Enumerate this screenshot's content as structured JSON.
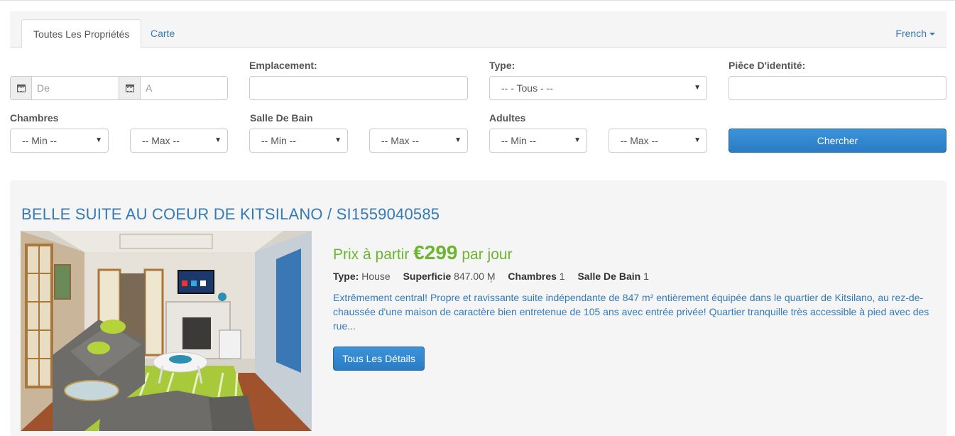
{
  "tabs": [
    {
      "label": "Toutes Les Propriétés",
      "active": true
    },
    {
      "label": "Carte",
      "active": false
    }
  ],
  "language": "French",
  "search": {
    "date_from_placeholder": "De",
    "date_to_placeholder": "A",
    "location_label": "Emplacement:",
    "location_value": "",
    "type_label": "Type:",
    "type_selected": "-- - Tous - --",
    "id_label": "Piêce D'identité:",
    "id_value": "",
    "bedrooms_label": "Chambres",
    "bathrooms_label": "Salle De Bain",
    "adults_label": "Adultes",
    "min_option": "-- Min --",
    "max_option": "-- Max --",
    "search_button": "Chercher"
  },
  "listing": {
    "title": "BELLE SUITE AU COEUR DE KITSILANO / SI1559040585",
    "price_prefix": "Prix à partir",
    "price_amount": "€299",
    "price_suffix": "par jour",
    "type_label": "Type:",
    "type_value": "House",
    "area_label": "Superficie",
    "area_value": "847.00 M̦",
    "bedrooms_label": "Chambres",
    "bedrooms_value": "1",
    "bathrooms_label": "Salle De Bain",
    "bathrooms_value": "1",
    "description": "Extrêmement central! Propre et ravissante suite indépendante de 847 m² entièrement équipée dans le quartier de Kitsilano, au rez-de-chaussée d'une maison de caractère bien entretenue de 105 ans avec entrée privée! Quartier tranquille très accessible à pied avec des rue...",
    "details_button": "Tous Les Détails"
  },
  "colors": {
    "link": "#337ab7",
    "price": "#6bb52f",
    "button": "#2a7cc4"
  }
}
